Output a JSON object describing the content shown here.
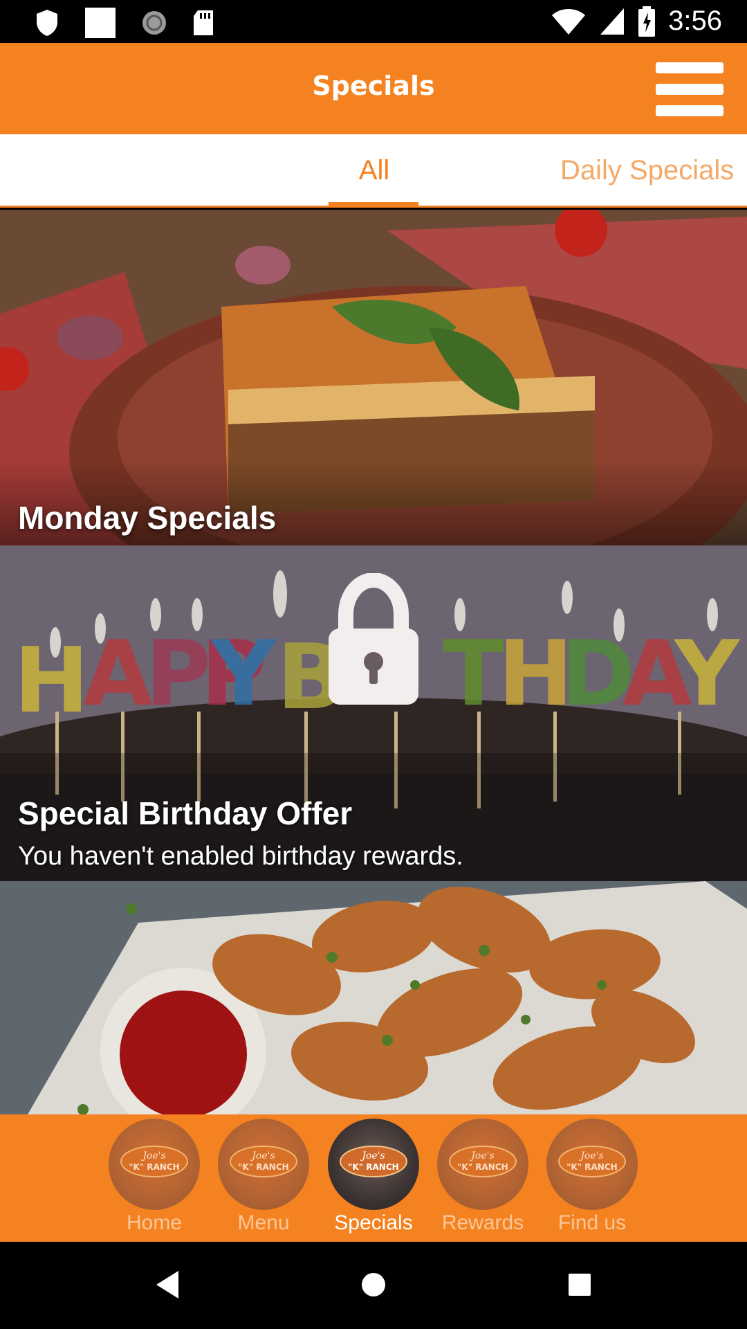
{
  "status_bar": {
    "time": "3:56",
    "icons": [
      "shield-icon",
      "square-icon",
      "sync-icon",
      "sd-card-icon",
      "wifi-icon",
      "signal-icon",
      "battery-charging-icon"
    ]
  },
  "app_bar": {
    "title": "Specials",
    "menu_icon": "hamburger-menu-icon"
  },
  "tabs": [
    {
      "label": "All",
      "selected": true
    },
    {
      "label": "Daily Specials",
      "selected": false
    }
  ],
  "cards": [
    {
      "title": "Monday Specials",
      "image": "lasagna-photo"
    },
    {
      "title": "Special Birthday Offer",
      "subtitle": "You haven't enabled birthday rewards.",
      "image": "birthday-candles-photo",
      "locked": true
    },
    {
      "title": "",
      "image": "chicken-wings-photo"
    }
  ],
  "bottom_nav": [
    {
      "label": "Home",
      "active": false
    },
    {
      "label": "Menu",
      "active": false
    },
    {
      "label": "Specials",
      "active": true
    },
    {
      "label": "Rewards",
      "active": false
    },
    {
      "label": "Find us",
      "active": false
    }
  ],
  "brand_logo_text": "Joe's \"K\" RANCH",
  "colors": {
    "primary": "#f58220",
    "tab_inactive": "#f5a866",
    "nav_label_inactive": "#fbc79a"
  }
}
